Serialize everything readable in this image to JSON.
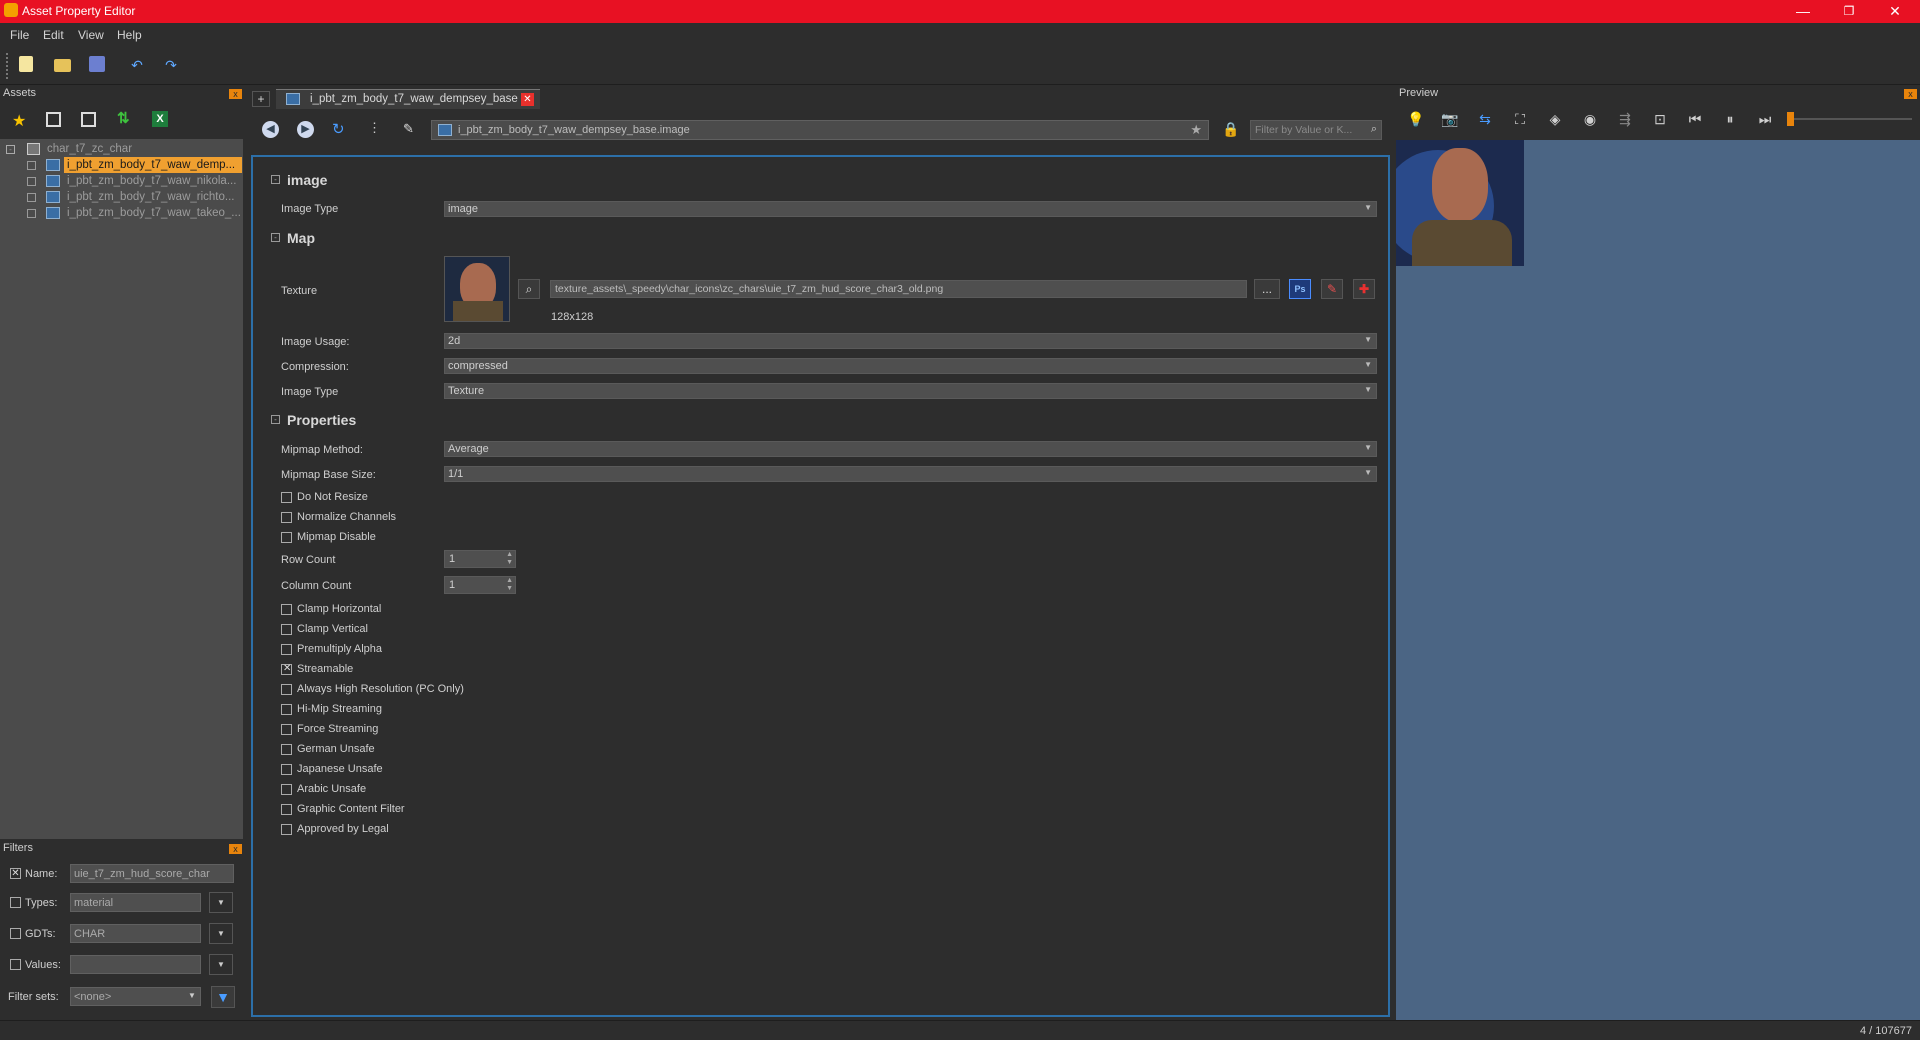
{
  "window": {
    "title": "Asset Property Editor",
    "min": "—",
    "max": "❐",
    "close": "✕"
  },
  "menu": [
    "File",
    "Edit",
    "View",
    "Help"
  ],
  "assets_panel": {
    "title": "Assets",
    "close": "x",
    "root": "char_t7_zc_char",
    "items": [
      {
        "label": "i_pbt_zm_body_t7_waw_demp...",
        "selected": true
      },
      {
        "label": "i_pbt_zm_body_t7_waw_nikola..."
      },
      {
        "label": "i_pbt_zm_body_t7_waw_richto..."
      },
      {
        "label": "i_pbt_zm_body_t7_waw_takeo_..."
      }
    ]
  },
  "filters_panel": {
    "title": "Filters",
    "close": "x",
    "name": {
      "label": "Name:",
      "value": "uie_t7_zm_hud_score_char",
      "checked": true
    },
    "types": {
      "label": "Types:",
      "value": "material"
    },
    "gdts": {
      "label": "GDTs:",
      "value": "CHAR"
    },
    "values": {
      "label": "Values:",
      "value": ""
    },
    "filter_sets": {
      "label": "Filter sets:",
      "value": "<none>"
    }
  },
  "editor": {
    "new_tab": "+",
    "tab_label": "i_pbt_zm_body_t7_waw_dempsey_base",
    "path": "i_pbt_zm_body_t7_waw_dempsey_base.image",
    "filter_placeholder": "Filter by Value or K..."
  },
  "sections": {
    "image": {
      "title": "image",
      "image_type_label": "Image Type",
      "image_type_value": "image"
    },
    "map": {
      "title": "Map",
      "texture_label": "Texture",
      "texture_path": "texture_assets\\_speedy\\char_icons\\zc_chars\\uie_t7_zm_hud_score_char3_old.png",
      "texture_size": "128x128",
      "browse": "...",
      "ps": "Ps",
      "image_usage_label": "Image Usage:",
      "image_usage_value": "2d",
      "compression_label": "Compression:",
      "compression_value": "compressed",
      "image_type_label": "Image Type",
      "image_type_value": "Texture"
    },
    "properties": {
      "title": "Properties",
      "mipmap_method_label": "Mipmap Method:",
      "mipmap_method_value": "Average",
      "mipmap_base_label": "Mipmap Base Size:",
      "mipmap_base_value": "1/1",
      "row_count_label": "Row Count",
      "row_count_value": "1",
      "column_count_label": "Column Count",
      "column_count_value": "1",
      "checks_a": [
        {
          "label": "Do Not Resize",
          "checked": false
        },
        {
          "label": "Normalize Channels",
          "checked": false
        },
        {
          "label": "Mipmap Disable",
          "checked": false
        }
      ],
      "checks_b": [
        {
          "label": "Clamp Horizontal",
          "checked": false
        },
        {
          "label": "Clamp Vertical",
          "checked": false
        },
        {
          "label": "Premultiply Alpha",
          "checked": false
        },
        {
          "label": "Streamable",
          "checked": true
        },
        {
          "label": "Always High Resolution (PC Only)",
          "checked": false
        },
        {
          "label": "Hi-Mip Streaming",
          "checked": false
        },
        {
          "label": "Force Streaming",
          "checked": false
        },
        {
          "label": "German Unsafe",
          "checked": false
        },
        {
          "label": "Japanese Unsafe",
          "checked": false
        },
        {
          "label": "Arabic Unsafe",
          "checked": false
        },
        {
          "label": "Graphic Content Filter",
          "checked": false
        },
        {
          "label": "Approved by Legal",
          "checked": false
        }
      ]
    }
  },
  "preview_panel": {
    "title": "Preview",
    "close": "x"
  },
  "status": {
    "count": "4 / 107677"
  },
  "colors": {
    "accent": "#f0a030",
    "titlebar": "#e81123",
    "preview_bg": "#4b6584",
    "frame": "#2c6fa8"
  }
}
